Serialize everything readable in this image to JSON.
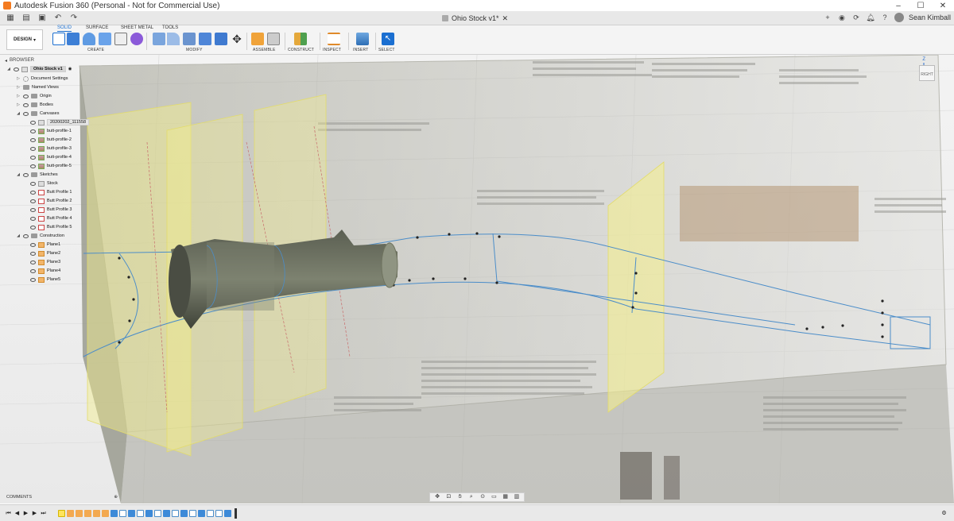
{
  "window": {
    "title": "Autodesk Fusion 360 (Personal - Not for Commercial Use)",
    "minimize": "–",
    "maximize": "☐",
    "close": "✕"
  },
  "tabbar": {
    "doc_tab": "Ohio Stock v1*",
    "user": "Sean Kimball"
  },
  "toolbar": {
    "workspace": "DESIGN",
    "tabs": [
      "SOLID",
      "SURFACE",
      "SHEET METAL",
      "TOOLS"
    ],
    "groups": [
      "CREATE",
      "MODIFY",
      "ASSEMBLE",
      "CONSTRUCT",
      "INSPECT",
      "INSERT",
      "SELECT"
    ],
    "accent": "#1b6fd1"
  },
  "browser": {
    "header": "BROWSER",
    "root": "Ohio Stock v1",
    "items": [
      {
        "label": "Document Settings"
      },
      {
        "label": "Named Views"
      },
      {
        "label": "Origin"
      },
      {
        "label": "Bodies"
      },
      {
        "label": "Canvases"
      },
      {
        "label": "20200202_111558"
      },
      {
        "label": "butt-profile-1"
      },
      {
        "label": "butt-profile-2"
      },
      {
        "label": "butt-profile-3"
      },
      {
        "label": "butt-profile-4"
      },
      {
        "label": "butt-profile-5"
      },
      {
        "label": "Sketches"
      },
      {
        "label": "Stock"
      },
      {
        "label": "Butt Profile 1"
      },
      {
        "label": "Butt Profile 2"
      },
      {
        "label": "Butt Profile 3"
      },
      {
        "label": "Butt Profile 4"
      },
      {
        "label": "Butt Profile 5"
      },
      {
        "label": "Construction"
      },
      {
        "label": "Plane1"
      },
      {
        "label": "Plane2"
      },
      {
        "label": "Plane3"
      },
      {
        "label": "Plane4"
      },
      {
        "label": "Plane5"
      }
    ]
  },
  "viewcube": {
    "face": "RIGHT",
    "axis_z": "Z"
  },
  "comments": {
    "label": "COMMENTS"
  }
}
